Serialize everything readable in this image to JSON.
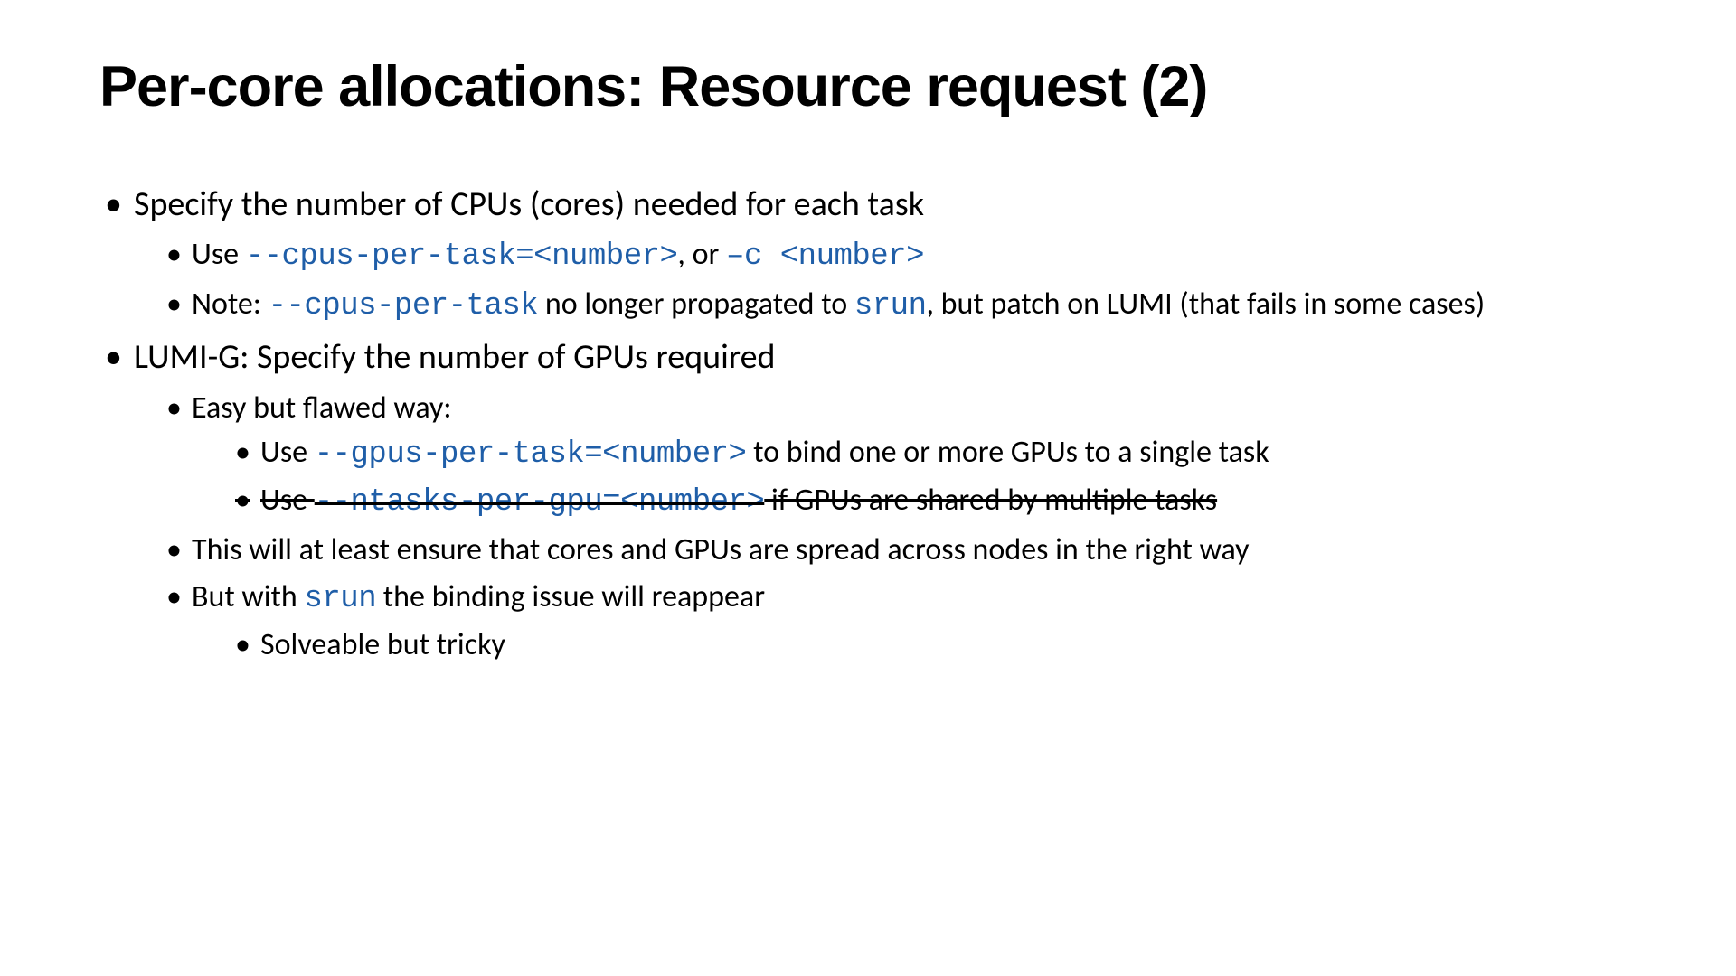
{
  "colors": {
    "code": "#1f5ea8",
    "text": "#000000",
    "background": "#ffffff"
  },
  "title": "Per-core allocations: Resource request (2)",
  "b1": {
    "text": "Specify the number of CPUs (cores) needed for each task",
    "sub1": {
      "pre": "Use ",
      "code1": "--cpus-per-task=<number>",
      "mid": ", or ",
      "code2": "–c <number>"
    },
    "sub2": {
      "pre": "Note: ",
      "code1": "--cpus-per-task",
      "mid": " no longer propagated to ",
      "code2": "srun",
      "post": ", but patch on LUMI (that fails in some cases)"
    }
  },
  "b2": {
    "text": "LUMI-G: Specify the number of GPUs required",
    "sub1": {
      "text": "Easy but flawed way:",
      "s1": {
        "pre": "Use ",
        "code1": "--gpus-per-task=<number>",
        "post": " to bind one or more GPUs to a single task"
      },
      "s2": {
        "pre": "Use ",
        "code1": "--ntasks-per-gpu=<number>",
        "post": " if GPUs are shared by multiple tasks"
      }
    },
    "sub2": {
      "text": "This will at least ensure that cores and GPUs are spread across nodes in the right way"
    },
    "sub3": {
      "pre": "But with ",
      "code1": "srun",
      "post": " the binding issue will reappear",
      "s1": {
        "text": "Solveable but tricky"
      }
    }
  }
}
